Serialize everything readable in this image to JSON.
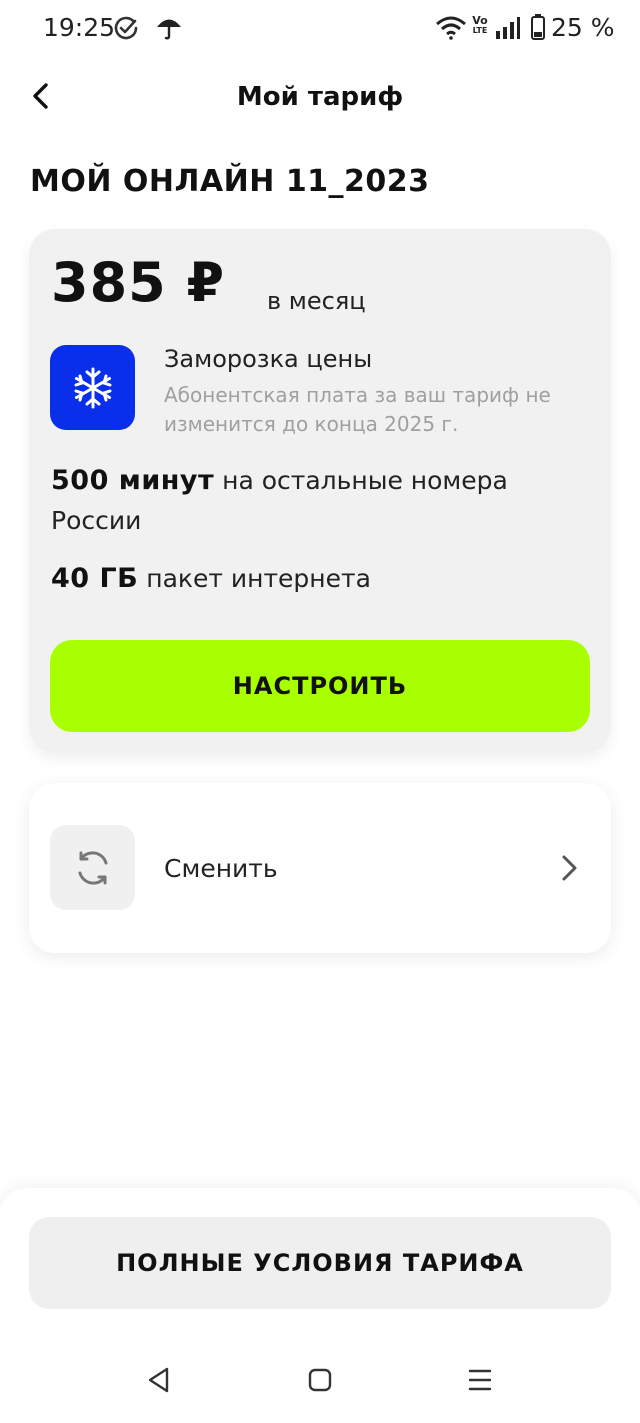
{
  "status_bar": {
    "time": "19:25",
    "volte_top": "Vo",
    "volte_bottom": "LTE",
    "battery_percent": "25 %",
    "icons": [
      "check-circle-icon",
      "umbrella-icon",
      "wifi-icon",
      "volte-icon",
      "signal-icon",
      "battery-icon"
    ]
  },
  "header": {
    "title": "Мой тариф",
    "back_icon": "chevron-left-icon"
  },
  "plan": {
    "name": "МОЙ ОНЛАЙН 11_2023",
    "price": "385 ₽",
    "price_unit": "в месяц",
    "freeze": {
      "icon": "snowflake-icon",
      "title": "Заморозка цены",
      "description": "Абонентская плата за ваш тариф не изменится до конца 2025 г."
    },
    "minutes": {
      "value": "500 минут",
      "text": "на остальные номера России"
    },
    "internet": {
      "value": "40 ГБ",
      "text": "пакет интернета"
    },
    "setup_button": "НАСТРОИТЬ"
  },
  "change": {
    "icon": "refresh-icon",
    "label": "Сменить",
    "chevron": "chevron-right-icon"
  },
  "terms_button": "ПОЛНЫЕ УСЛОВИЯ ТАРИФА",
  "nav": {
    "icons": [
      "nav-back-icon",
      "nav-home-icon",
      "nav-menu-icon"
    ]
  },
  "colors": {
    "accent_green": "#a8ff00",
    "freeze_blue": "#0a2fea",
    "card_bg": "#f1f1f1"
  }
}
